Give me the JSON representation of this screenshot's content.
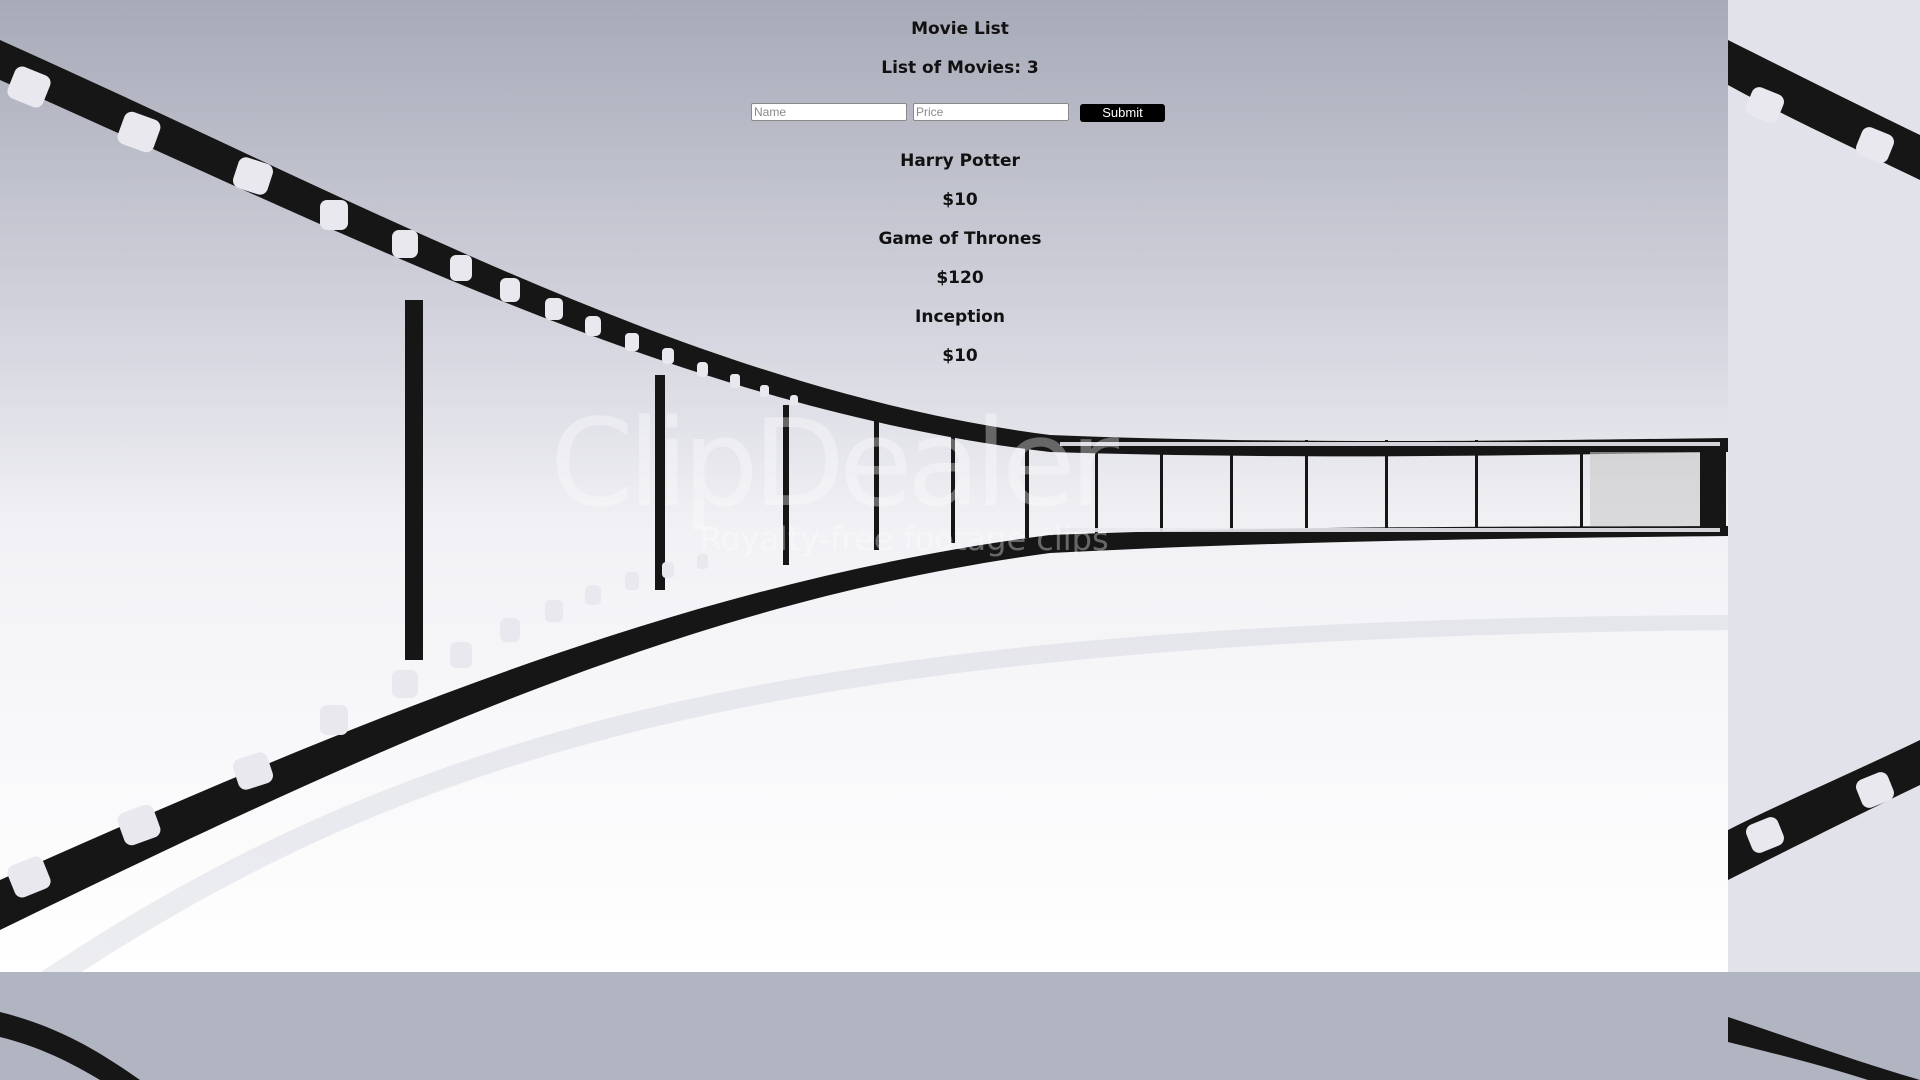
{
  "page": {
    "title": "Movie List",
    "count_label": "List of Movies: 3"
  },
  "form": {
    "name_placeholder": "Name",
    "price_placeholder": "Price",
    "submit_label": "Submit"
  },
  "movies": [
    {
      "name": "Harry Potter",
      "price": "$10"
    },
    {
      "name": "Game of Thrones",
      "price": "$120"
    },
    {
      "name": "Inception",
      "price": "$10"
    }
  ],
  "background": {
    "image": "film-strip",
    "watermark_main": "ClipDealer",
    "watermark_sub": "Royalty-free footage clips",
    "colors": {
      "sky_top": "#a9acba",
      "sky_mid": "#d8d9e2",
      "floor": "#ffffff",
      "film": "#151515"
    }
  }
}
